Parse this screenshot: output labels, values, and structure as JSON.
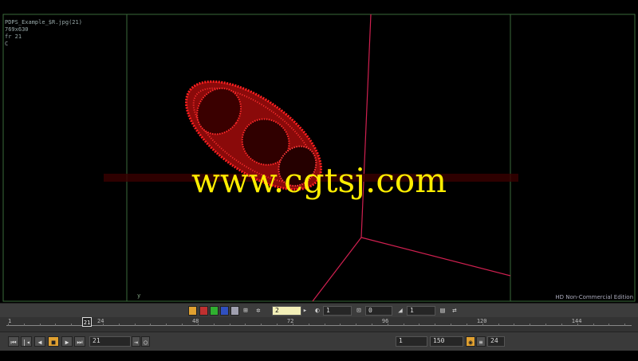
{
  "viewer": {
    "file_info": "PDPS_Example_$R.jpg(21)",
    "resolution": "769x630",
    "frame_info": "fr 21",
    "channel": "C",
    "watermark": "www.cgtsj.com",
    "edition": "HD Non-Commercial Edition",
    "axis_label": "y"
  },
  "toolbar": {
    "swatch_colors": [
      "#e0a030",
      "#c03030",
      "#30b030",
      "#3050c0",
      "#a0a0b0"
    ],
    "gain_value": "2",
    "gamma_value": "1",
    "zoom_value": "0",
    "fstop_value": "1"
  },
  "timeline": {
    "start_label": "1",
    "ticks": [
      "24",
      "48",
      "72",
      "96",
      "120",
      "144"
    ],
    "current_frame": "21"
  },
  "transport": {
    "frame_field": "21",
    "in_point": "1",
    "out_point": "150",
    "fps": "24"
  }
}
